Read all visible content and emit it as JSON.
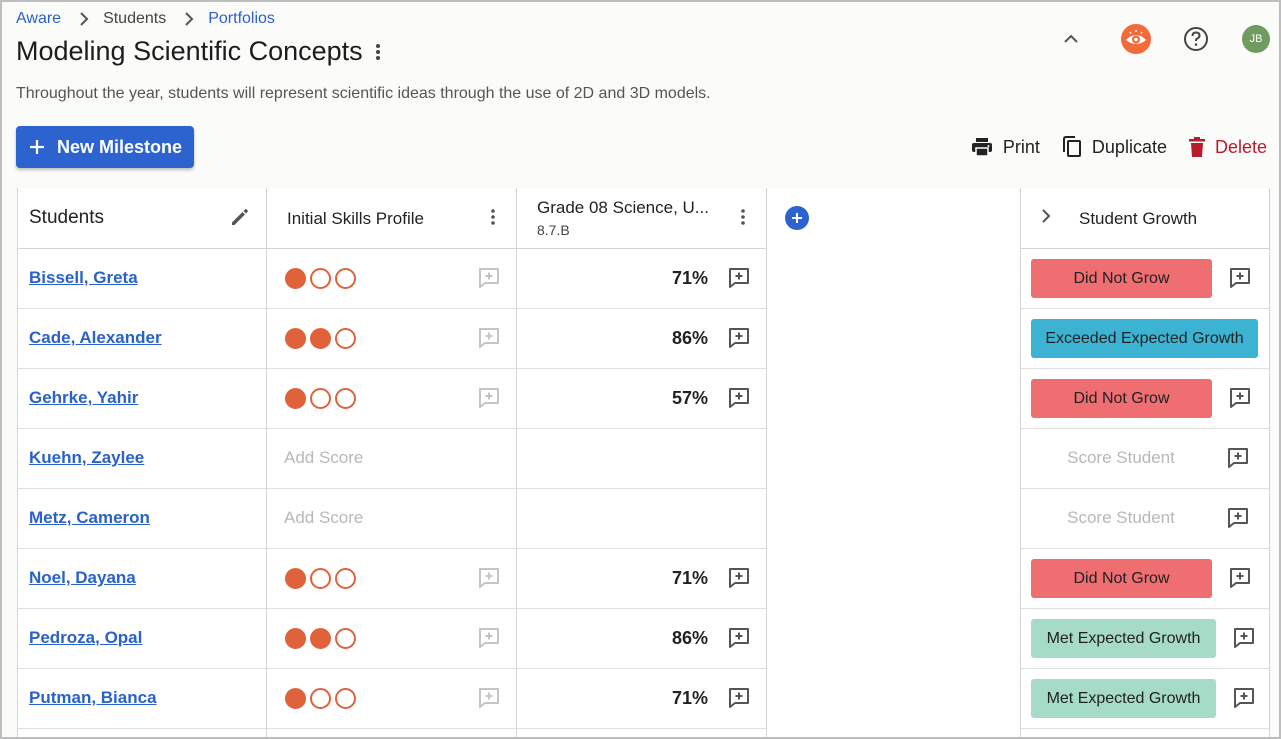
{
  "breadcrumb": [
    "Aware",
    "Students",
    "Portfolios"
  ],
  "page": {
    "title": "Modeling Scientific Concepts",
    "description": "Throughout the year, students will represent scientific ideas through the use of 2D and 3D models."
  },
  "user": {
    "initials": "JB"
  },
  "toolbar": {
    "new_milestone": "New Milestone",
    "print": "Print",
    "duplicate": "Duplicate",
    "delete": "Delete"
  },
  "colors": {
    "primary": "#2c63cf",
    "dot": "#e0623a",
    "did_not_grow": "#ee6e72",
    "exceeded": "#3db3d4",
    "met": "#a5dbc7",
    "delete": "#b71c2c"
  },
  "icons": [
    "chevron-right-icon",
    "kebab-icon",
    "chevron-up-icon",
    "eye-icon",
    "help-icon",
    "plus-icon",
    "print-icon",
    "duplicate-icon",
    "delete-icon",
    "pencil-icon",
    "add-comment-icon",
    "add-circle-icon"
  ],
  "table": {
    "headers": {
      "students": "Students",
      "initial": "Initial Skills Profile",
      "grade_title": "Grade 08 Science, U...",
      "grade_sub": "8.7.B",
      "growth": "Student Growth"
    },
    "add_score_label": "Add Score",
    "score_student_label": "Score Student",
    "rows": [
      {
        "name": "Bissell, Greta",
        "initial_dots": 1,
        "grade": "71%",
        "growth": "Did Not Grow",
        "growth_type": "red"
      },
      {
        "name": "Cade, Alexander",
        "initial_dots": 2,
        "grade": "86%",
        "growth": "Exceeded Expected Growth",
        "growth_type": "blue"
      },
      {
        "name": "Gehrke, Yahir",
        "initial_dots": 1,
        "grade": "57%",
        "growth": "Did Not Grow",
        "growth_type": "red"
      },
      {
        "name": "Kuehn, Zaylee",
        "initial_dots": 0,
        "grade": "",
        "growth": "",
        "growth_type": "none"
      },
      {
        "name": "Metz, Cameron",
        "initial_dots": 0,
        "grade": "",
        "growth": "",
        "growth_type": "none"
      },
      {
        "name": "Noel, Dayana",
        "initial_dots": 1,
        "grade": "71%",
        "growth": "Did Not Grow",
        "growth_type": "red"
      },
      {
        "name": "Pedroza, Opal",
        "initial_dots": 2,
        "grade": "86%",
        "growth": "Met Expected Growth",
        "growth_type": "green"
      },
      {
        "name": "Putman, Bianca",
        "initial_dots": 1,
        "grade": "71%",
        "growth": "Met Expected Growth",
        "growth_type": "green"
      }
    ]
  }
}
